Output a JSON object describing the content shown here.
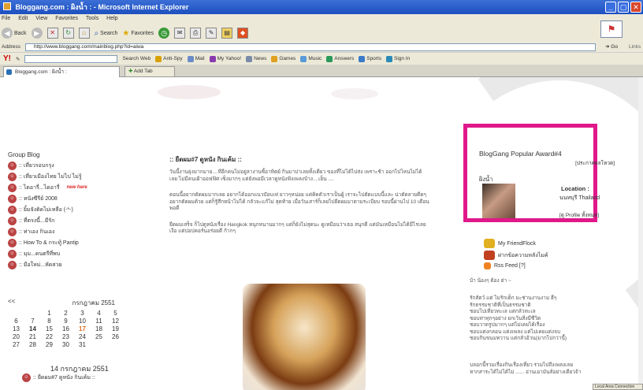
{
  "window": {
    "title": "Bloggang.com : ผิงน้ำ : - Microsoft Internet Explorer"
  },
  "menu": [
    "File",
    "Edit",
    "View",
    "Favorites",
    "Tools",
    "Help"
  ],
  "toolbar": {
    "back": "Back",
    "search": "Search",
    "favorites": "Favorites"
  },
  "address": {
    "label": "Address",
    "url": "http://www.bloggang.com/mainblog.php?id=aiwa",
    "go": "Go",
    "links": "Links"
  },
  "yahoo": {
    "search_web": "Search Web",
    "buttons": [
      "Anti-Spy",
      "Mail",
      "My Yahoo!",
      "News",
      "Games",
      "Music",
      "Answers",
      "Sports",
      "Sign In"
    ]
  },
  "tabs": {
    "active": "Bloggang.com : ผิงน้ำ :",
    "add": "Add Tab"
  },
  "sidebar": {
    "title": "Group Blog",
    "items": [
      {
        "label": ":: เที่ยวรอบกรุง",
        "badge": ""
      },
      {
        "label": ":: เที่ยวเมืองไทย ไม่ไป ไม่รู้",
        "badge": ""
      },
      {
        "label": ":: ไดอารี่...ไดอารี่",
        "badge": "new here"
      },
      {
        "label": ":: หนังซีรีย์ 2008",
        "badge": ""
      },
      {
        "label": ":: ยิ้มจังติดไม่เหลือ (-*-)",
        "badge": ""
      },
      {
        "label": ":: ที่ตรงนี้...มีรัก",
        "badge": ""
      },
      {
        "label": ":: ท่าเอง กินเอง",
        "badge": ""
      },
      {
        "label": ":: How To & กระทู้ Pantip",
        "badge": ""
      },
      {
        "label": ":: มุม...ดนตรีที่พบ",
        "badge": ""
      },
      {
        "label": ":: มือใหม่...หัดสวย",
        "badge": ""
      }
    ]
  },
  "calendar": {
    "prev": "<<",
    "month": "กรกฎาคม 2551",
    "days": [
      "",
      "",
      "1",
      "2",
      "3",
      "4",
      "5",
      "6",
      "7",
      "8",
      "9",
      "10",
      "11",
      "12",
      "13",
      "14",
      "15",
      "16",
      "17",
      "18",
      "19",
      "20",
      "21",
      "22",
      "23",
      "24",
      "25",
      "26",
      "27",
      "28",
      "29",
      "30",
      "31",
      "",
      ""
    ],
    "today": "17",
    "bold_days": [
      "14"
    ]
  },
  "recent": {
    "date": "14 กรกฎาคม 2551",
    "entry": ":: ยืดผม#7 ดูหนัง กินเค้ม ::"
  },
  "post": {
    "title": ":: ยืดผม#7 ดูหนัง กินเค้ม ::",
    "paragraphs": [
      "วันนี้งานยุ่งมากมาย....ทีอีกคนไม่อยู่ลางานซิ้อาทิตย์ กินมาปาเลยทั้งเดียว ของที่ไม่ได้ไปส่ง เพราะช้า ออกไปไหนไม่ได้เลย ไม่มีคนเฝ้าออฟฟิศ เซ็งมากๆ แต่ยังพอมีเวลาดูหนังฟังเพลงบ้าง....เย็น ....",
      "ตอนนี้อยากตัดผมมากเลย อยากได้ออกแนวบ๊อบเท่ ยาวๆหน่อย แต่คิดตัวเราเป็นผู้ เราจะไปตัดแบบนี้และ น่าตัดลายดีดๆ อยากตัดผมด้วย แต่ก็รู้สึกหน้าไม่ได้ กลัวจะแก้ไม่ สุดท้าย เมื่อวันเสาร์ก็เลยไปยืดผมมาตามระเบียบ รอบนี้ผ่านไป 10 เดือนพอดี",
      "ยืดผมเสร็จ ก็ไปดูหนังเรื่อง Hangkok หนุกหนานมากๆ แต่ก็ยังไม่สุดนะ ดูเหมือนว่าเธอ สนุกดี แต่มันเหมือนไม่ได้มีไรเลย เงือ แต่ปอปคอร์นอร่อยดี ก้ากๆ"
    ]
  },
  "award": {
    "title": "BlogGang Popular Award#4",
    "subtitle": "[ประกาศผลโหวต]",
    "username": "ผิงน้ำ",
    "location_label": "Location :",
    "location": "นนทบุรี Thailand",
    "profile_link": "[ดู Profile ทั้งหมด]"
  },
  "links": {
    "friendflock": "My FriendFlock",
    "messages": "ฝากข้อความหลังไมค์",
    "rss": "Rss Feed [?]"
  },
  "about": {
    "greeting": "บ้า น้องๆ ต้อง ฮ่า ~",
    "lines": [
      "รักสัตว์ แต่ ไม่รักเด็ก มะช่านงานงาม ฮี่ๆ",
      "รักธรรมชาติที่เป็นธรรมชาติ",
      "ชอบไปเที่ยวทะเล แต่กลัวทะเล",
      "ชอบท่าทุกๆอย่าง ยกเว้นสิ่งมีชีวิต",
      "ชอบวาดรูปมากๆ แต่ไม่เคยได้เรื่อง",
      "ชอบแต่งกลอน แต่งเพลง แต่ไม่เคยแต่งจบ",
      "ชอบกินขนมหวาน แต่กลัวอ้วน(มากไปกว่านี้)"
    ],
    "footer": [
      "บลอกนี้รวมเรื่องกินเรื่องเที่ยว รวมไปถึงเพลงเลย",
      "หากสาระได้ไม่ได้ไม่ ...... อ่านเอามันส์อย่างเดียวจ้า"
    ]
  },
  "status": {
    "zone": "Local Area Connection"
  }
}
